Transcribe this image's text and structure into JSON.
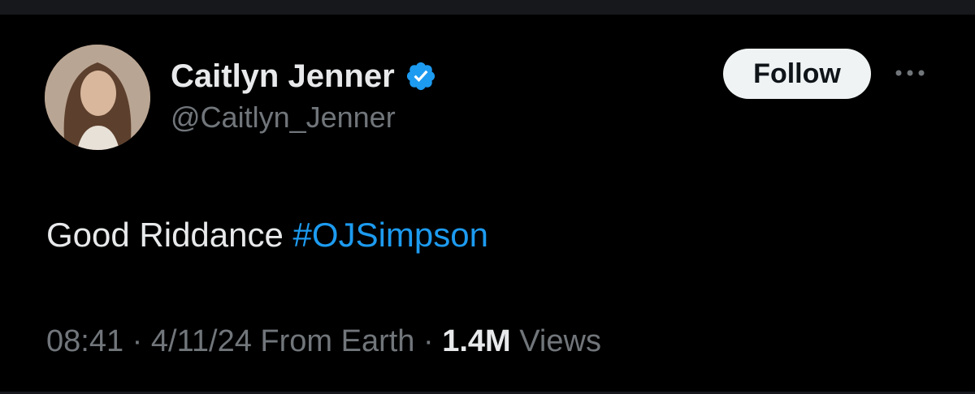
{
  "author": {
    "name": "Caitlyn Jenner",
    "handle": "@Caitlyn_Jenner",
    "verified_icon": "verified-badge-icon"
  },
  "header": {
    "follow_label": "Follow",
    "more_icon": "more-options-icon"
  },
  "tweet": {
    "text_prefix": "Good Riddance ",
    "hashtag": "#OJSimpson"
  },
  "meta": {
    "time": "08:41",
    "separator": " · ",
    "date": "4/11/24",
    "location": " From Earth",
    "views_count": "1.4M",
    "views_label": " Views"
  },
  "colors": {
    "background": "#000000",
    "text_primary": "#e7e9ea",
    "text_secondary": "#71767b",
    "accent": "#1d9bf0",
    "follow_bg": "#eff3f4"
  }
}
